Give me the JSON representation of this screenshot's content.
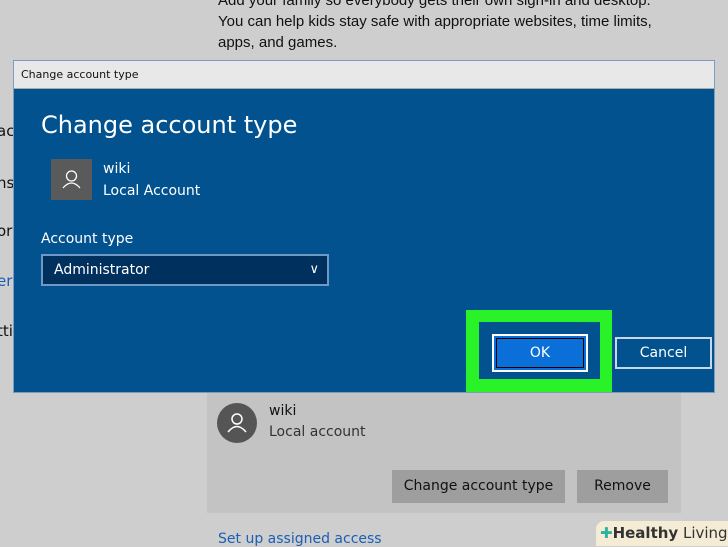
{
  "background": {
    "description_lines": [
      "Add your family so everybody gets their own sign-in and desktop.",
      "You can help kids stay safe with appropriate websites, time limits,",
      "apps, and games."
    ],
    "side_fragments": [
      "ac",
      "ns",
      "or",
      "er",
      "tti"
    ],
    "account_card": {
      "name": "wiki",
      "type": "Local account",
      "change_button": "Change account type",
      "remove_button": "Remove"
    },
    "link": "Set up assigned access"
  },
  "dialog": {
    "window_title": "Change account type",
    "heading": "Change account type",
    "user": {
      "name": "wiki",
      "type": "Local Account"
    },
    "account_type_label": "Account type",
    "account_type_value": "Administrator",
    "ok": "OK",
    "cancel": "Cancel"
  },
  "watermark": {
    "text_bold": "Healthy",
    "text": " Living"
  },
  "colors": {
    "dialog_bg": "#01528f",
    "highlight": "#29f229",
    "ok_button": "#0a6fd8"
  }
}
